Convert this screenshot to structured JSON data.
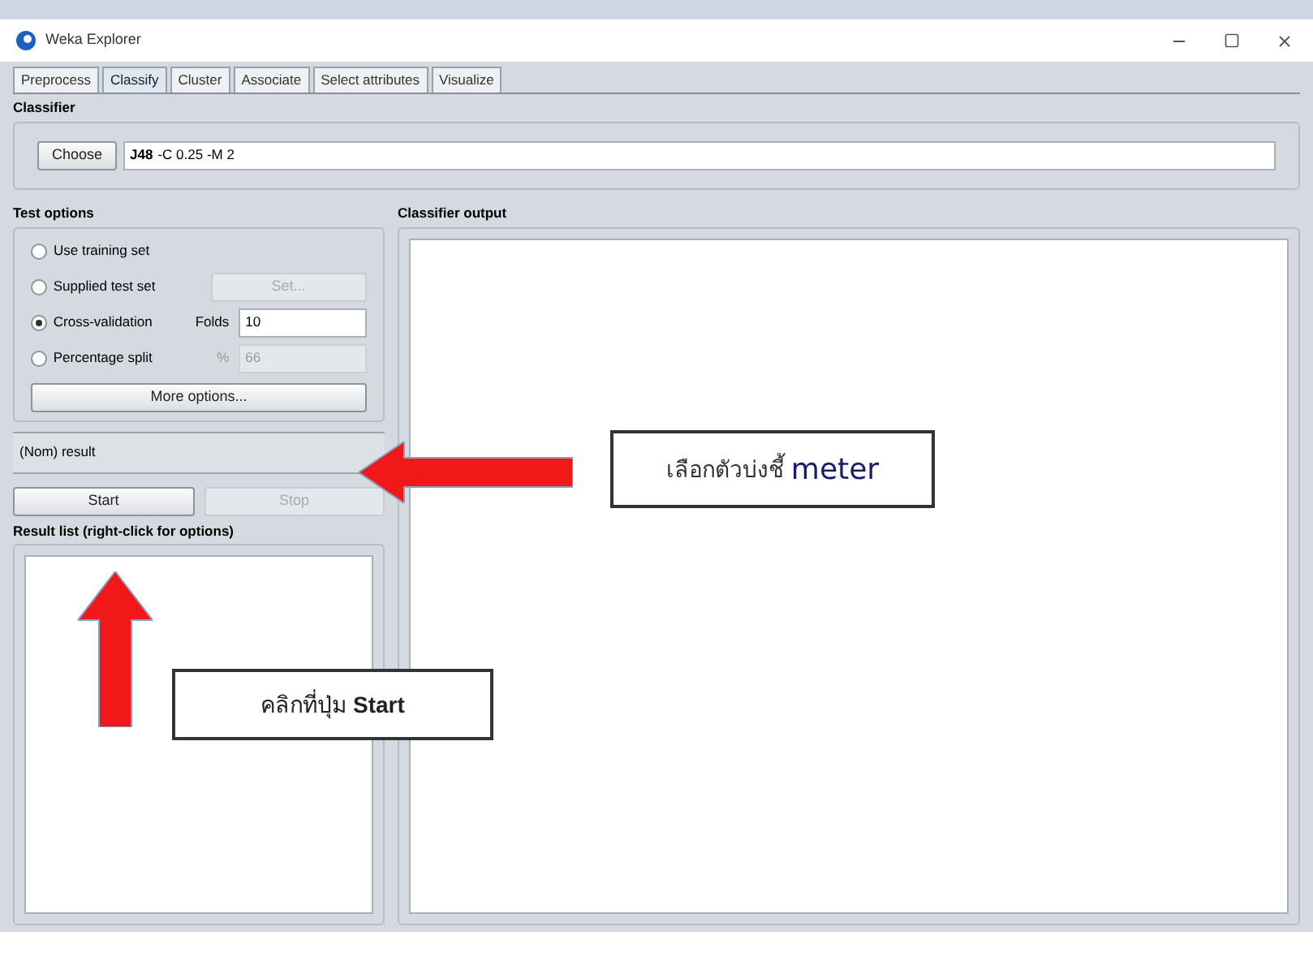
{
  "window": {
    "title": "Weka Explorer"
  },
  "tabs": [
    {
      "label": "Preprocess",
      "selected": false
    },
    {
      "label": "Classify",
      "selected": true
    },
    {
      "label": "Cluster",
      "selected": false
    },
    {
      "label": "Associate",
      "selected": false
    },
    {
      "label": "Select attributes",
      "selected": false
    },
    {
      "label": "Visualize",
      "selected": false
    }
  ],
  "classifier": {
    "heading": "Classifier",
    "button": "Choose",
    "name": "J48",
    "options": "-C 0.25 -M 2"
  },
  "test_options": {
    "heading": "Test options",
    "options": [
      {
        "label": "Use training set",
        "selected": false
      },
      {
        "label": "Supplied test set",
        "selected": false,
        "button": {
          "label": "Set...",
          "disabled": true
        }
      },
      {
        "label": "Cross-validation",
        "selected": true,
        "field": {
          "label": "Folds",
          "value": "10",
          "disabled": false
        }
      },
      {
        "label": "Percentage split",
        "selected": false,
        "field": {
          "label": "%",
          "value": "66",
          "disabled": true
        }
      }
    ],
    "more_button": "More options..."
  },
  "class_select": {
    "value": "(Nom) result"
  },
  "actions": [
    {
      "label": "Start",
      "disabled": false
    },
    {
      "label": "Stop",
      "disabled": true
    }
  ],
  "result_list": {
    "heading": "Result list (right-click for options)"
  },
  "output": {
    "heading": "Classifier output"
  },
  "annotations": [
    {
      "text": "เลือกตัวบ่งชี้",
      "highlight": "meter"
    },
    {
      "text": "คลิกที่ปุ่ม **Start**"
    }
  ]
}
